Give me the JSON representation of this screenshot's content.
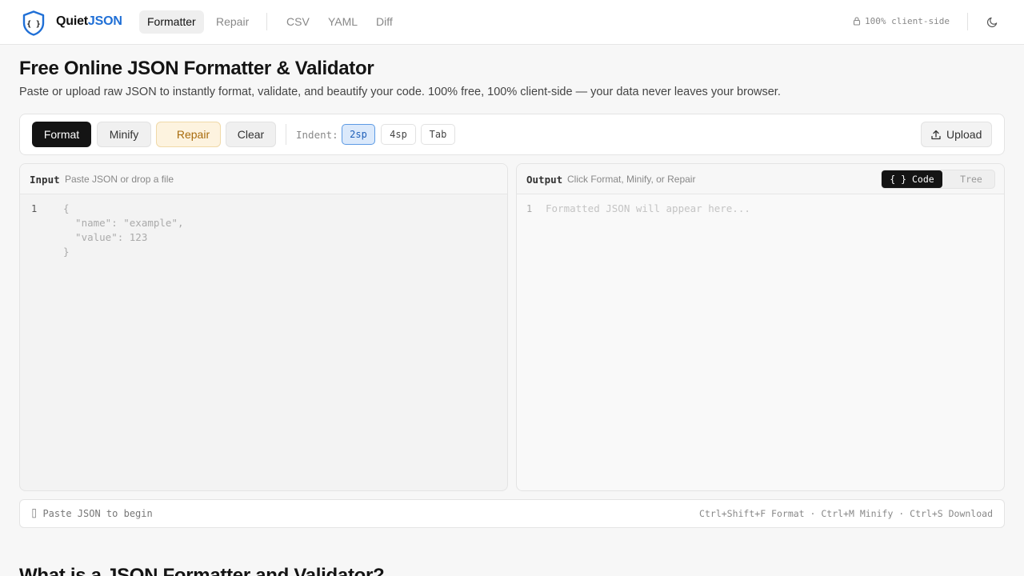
{
  "brand": {
    "part1": "Quiet",
    "part2": "JSON",
    "accent": "#1f6fd6"
  },
  "nav": [
    {
      "label": "Formatter",
      "active": true
    },
    {
      "label": "Repair"
    },
    {
      "label": "CSV"
    },
    {
      "label": "YAML"
    },
    {
      "label": "Diff"
    }
  ],
  "header": {
    "client_side": "100% client-side",
    "lock_icon": "lock-icon",
    "theme_icon": "moon-icon"
  },
  "page": {
    "title": "Free Online JSON Formatter & Validator",
    "subtitle": "Paste or upload raw JSON to instantly format, validate, and beautify your code. 100% free, 100% client-side — your data never leaves your browser."
  },
  "toolbar": {
    "format": "Format",
    "minify": "Minify",
    "repair": "Repair",
    "clear": "Clear",
    "indent_label": "Indent:",
    "indent_options": [
      "2sp",
      "4sp",
      "Tab"
    ],
    "indent_selected": "2sp",
    "upload": "Upload"
  },
  "input_panel": {
    "title": "Input",
    "hint": "Paste JSON or drop a file",
    "line_number": "1",
    "placeholder_lines": [
      "{",
      "  \"name\": \"example\",",
      "  \"value\": 123",
      "}"
    ]
  },
  "output_panel": {
    "title": "Output",
    "hint": "Click Format, Minify, or Repair",
    "view_code": "{ } Code",
    "view_tree": "Tree",
    "line_number": "1",
    "placeholder": "Formatted JSON will appear here..."
  },
  "status": {
    "left": "⌷ Paste JSON to begin",
    "right": "Ctrl+Shift+F Format · Ctrl+M Minify · Ctrl+S Download"
  },
  "section": {
    "title": "What is a JSON Formatter and Validator?"
  }
}
